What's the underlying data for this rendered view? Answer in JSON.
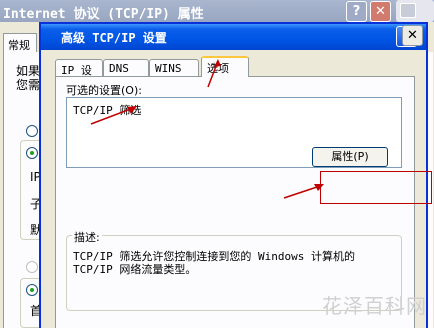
{
  "back_window": {
    "title": "Internet 协议 (TCP/IP) 属性",
    "help": "?",
    "close": "✕",
    "tab_general": "常规",
    "partial_text_1": "如果",
    "partial_text_2": "您需",
    "row_ip": "IP",
    "row_subnet": "子",
    "row_default": "默",
    "row_preferred": "首"
  },
  "dialog": {
    "title": "高级 TCP/IP 设置",
    "help": "?",
    "close": "✕",
    "tabs": [
      "IP 设置",
      "DNS",
      "WINS",
      "选项"
    ],
    "optional_settings_label": "可选的设置(O):",
    "list_items": [
      "TCP/IP 筛选"
    ],
    "properties_button": "属性(P)",
    "description_label": "描述:",
    "description_text": "TCP/IP 筛选允许您控制连接到您的 Windows 计算机的\nTCP/IP 网络流量类型。"
  },
  "watermark": "花泽百科网",
  "colors": {
    "title_blue": "#0055e5",
    "annotation_red": "#c00000",
    "tab_highlight": "#ffc83c"
  }
}
